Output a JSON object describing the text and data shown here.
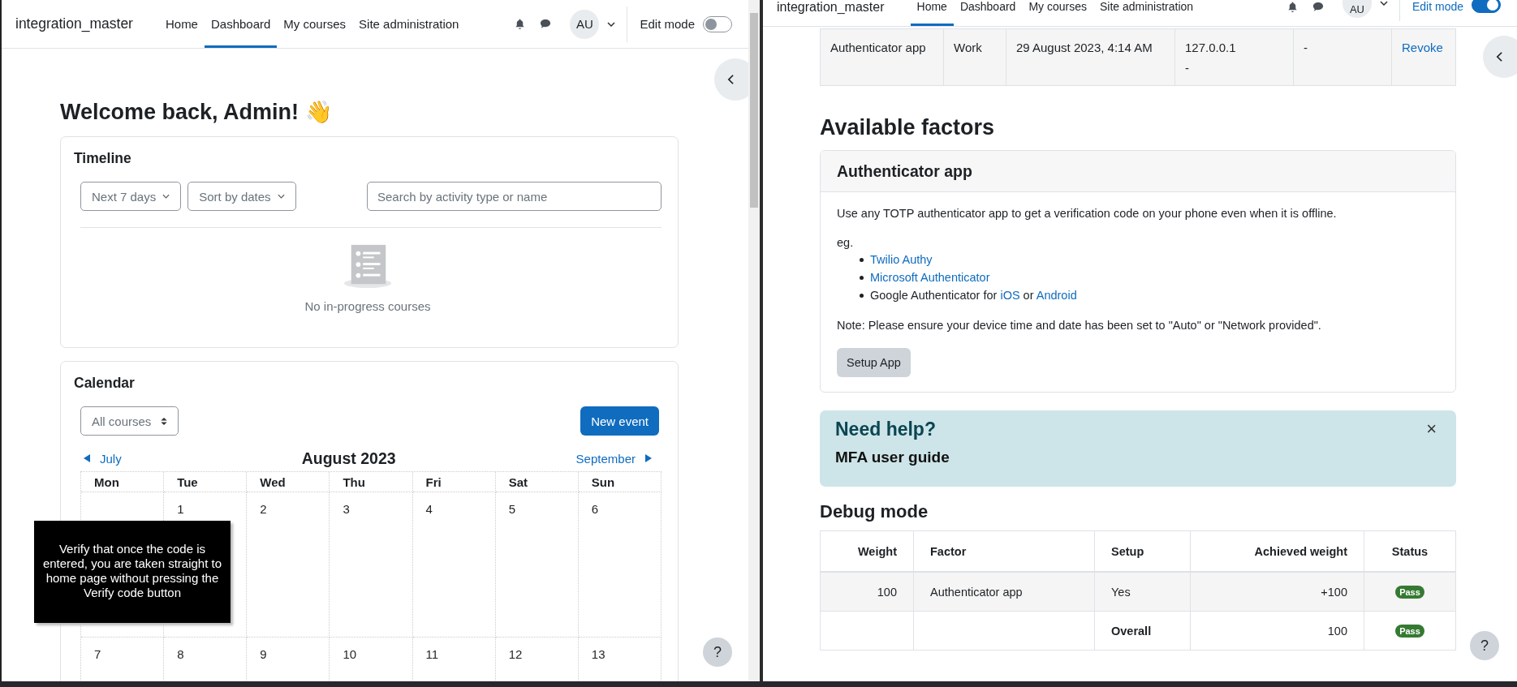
{
  "left_window": {
    "navbar": {
      "brand": "integration_master",
      "items": [
        {
          "label": "Home",
          "selected": false
        },
        {
          "label": "Dashboard",
          "selected": true
        },
        {
          "label": "My courses",
          "selected": false
        },
        {
          "label": "Site administration",
          "selected": false
        }
      ],
      "avatar": "AU",
      "edit_mode": {
        "label": "Edit mode",
        "on": false
      }
    },
    "welcome": "Welcome back, Admin! 👋",
    "timeline": {
      "title": "Timeline",
      "filters": [
        "Next 7 days",
        "Sort by dates"
      ],
      "search": {
        "placeholder": "Search by activity type or name"
      },
      "empty_text": "No in-progress courses"
    },
    "calendar": {
      "title": "Calendar",
      "course_filter": "All courses",
      "new_event": "New event",
      "prev": "July",
      "month": "August 2023",
      "next": "September",
      "weekdays": [
        "Mon",
        "Tue",
        "Wed",
        "Thu",
        "Fri",
        "Sat",
        "Sun"
      ],
      "weeks": [
        [
          {
            "kind": "blank"
          },
          {
            "kind": "day",
            "day": "1"
          },
          {
            "kind": "day",
            "day": "2"
          },
          {
            "kind": "day",
            "day": "3"
          },
          {
            "kind": "day",
            "day": "4"
          },
          {
            "kind": "day",
            "day": "5"
          },
          {
            "kind": "day",
            "day": "6"
          }
        ],
        [
          {
            "kind": "day",
            "day": "7"
          },
          {
            "kind": "day",
            "day": "8"
          },
          {
            "kind": "day",
            "day": "9"
          },
          {
            "kind": "day",
            "day": "10"
          },
          {
            "kind": "day",
            "day": "11"
          },
          {
            "kind": "day",
            "day": "12"
          },
          {
            "kind": "day",
            "day": "13"
          }
        ]
      ]
    },
    "tooltip": "Verify that once the code is entered, you are taken straight to home page without pressing the Verify code button",
    "help": "?"
  },
  "right_window": {
    "navbar": {
      "brand": "integration_master",
      "items": [
        {
          "label": "Home",
          "selected": true
        },
        {
          "label": "Dashboard",
          "selected": false
        },
        {
          "label": "My courses",
          "selected": false
        },
        {
          "label": "Site administration",
          "selected": false
        }
      ],
      "avatar": "AU",
      "edit_mode": {
        "label": "Edit mode",
        "on": true
      }
    },
    "session_row": [
      {
        "kind": "text",
        "lines": [
          "Authenticator app"
        ]
      },
      {
        "kind": "text",
        "lines": [
          "Work"
        ]
      },
      {
        "kind": "text",
        "lines": [
          "29 August 2023, 4:14 AM"
        ]
      },
      {
        "kind": "text",
        "lines": [
          "127.0.0.1",
          "-"
        ]
      },
      {
        "kind": "text",
        "lines": [
          "-"
        ]
      },
      {
        "kind": "link",
        "lines": [
          "Revoke"
        ]
      }
    ],
    "available_factors": {
      "title": "Available factors",
      "card": {
        "title": "Authenticator app",
        "description": "Use any TOTP authenticator app to get a verification code on your phone even when it is offline.",
        "eg": "eg.",
        "apps": [
          [
            {
              "kind": "link",
              "text": "Twilio Authy"
            }
          ],
          [
            {
              "kind": "link",
              "text": "Microsoft Authenticator"
            }
          ],
          [
            {
              "kind": "text",
              "text": "Google Authenticator for "
            },
            {
              "kind": "link",
              "text": "iOS"
            },
            {
              "kind": "text",
              "text": " or "
            },
            {
              "kind": "link",
              "text": "Android"
            }
          ]
        ],
        "note": "Note: Please ensure your device time and date has been set to \"Auto\" or \"Network provided\".",
        "button": "Setup App"
      }
    },
    "help_box": {
      "title": "Need help?",
      "guide": "MFA user guide",
      "close": "×"
    },
    "debug": {
      "title": "Debug mode",
      "columns": [
        "Weight",
        "Factor",
        "Setup",
        "Achieved weight",
        "Status"
      ],
      "rows": [
        {
          "kind": "factor",
          "weight": "100",
          "factor": "Authenticator app",
          "setup": "Yes",
          "achieved": "+100",
          "status": {
            "label": "Pass",
            "color": "#357a32"
          }
        },
        {
          "kind": "total",
          "weight": null,
          "factor": null,
          "setup": "Overall",
          "achieved": "100",
          "status": {
            "label": "Pass",
            "color": "#357a32"
          }
        }
      ]
    },
    "help": "?"
  }
}
